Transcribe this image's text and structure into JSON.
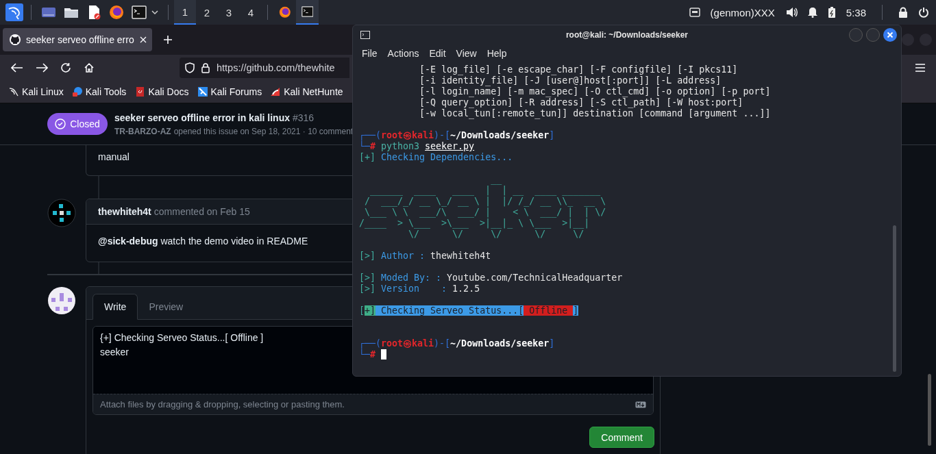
{
  "taskbar": {
    "launchers": [
      {
        "kind": "kali"
      },
      {
        "kind": "desktop"
      },
      {
        "kind": "files"
      },
      {
        "kind": "document"
      },
      {
        "kind": "browser"
      },
      {
        "kind": "terminal"
      }
    ],
    "workspaces": [
      {
        "label": "1",
        "selected": true
      },
      {
        "label": "2",
        "selected": false
      },
      {
        "label": "3",
        "selected": false
      },
      {
        "label": "4",
        "selected": false
      }
    ],
    "tasks": [
      {
        "kind": "browser",
        "selected": false
      },
      {
        "kind": "terminal",
        "selected": true
      }
    ],
    "tray": {
      "genmon": "(genmon)XXX",
      "clock": "5:38"
    }
  },
  "browser": {
    "tabs": [
      {
        "title": "seeker serveo offline erro",
        "selected": true
      }
    ],
    "address": "https://github.com/thewhite",
    "bookmarks": [
      {
        "label": "Kali Linux",
        "kind": "dragon"
      },
      {
        "label": "Kali Tools",
        "kind": "tools"
      },
      {
        "label": "Kali Docs",
        "kind": "docs"
      },
      {
        "label": "Kali Forums",
        "kind": "forums"
      },
      {
        "label": "Kali NetHunte",
        "kind": "nethunter"
      }
    ]
  },
  "issue": {
    "state": "Closed",
    "title": "seeker serveo offline error in kali linux",
    "number": "#316",
    "author": "TR-BARZO-AZ",
    "meta": "opened this issue on Sep 18, 2021 · 10 comment",
    "previous_comment_tail": "manual",
    "comment": {
      "author": "thewhiteh4t",
      "meta": "commented on Feb 15",
      "body": "**@sick-debug** watch the demo video in README"
    },
    "composer": {
      "tabs": [
        {
          "label": "Write",
          "selected": true
        },
        {
          "label": "Preview",
          "selected": false
        }
      ],
      "value": "{+] Checking Serveo Status...[ Offline ]\nseeker",
      "hint": "Attach files by dragging & dropping, selecting or pasting them.",
      "submit": "Comment"
    }
  },
  "terminal": {
    "title": "root@kali: ~/Downloads/seeker",
    "menu": [
      "File",
      "Actions",
      "Edit",
      "View",
      "Help"
    ],
    "lines": [
      {
        "kind": "text",
        "segments": [
          {
            "text": "           [-E log_file] [-e escape_char] [-F configfile] [-I pkcs11]",
            "kind": "plain"
          }
        ]
      },
      {
        "kind": "text",
        "segments": [
          {
            "text": "           [-i identity_file] [-J [user@]host[:port]] [-L address]",
            "kind": "plain"
          }
        ]
      },
      {
        "kind": "text",
        "segments": [
          {
            "text": "           [-l login_name] [-m mac_spec] [-O ctl_cmd] [-o option] [-p port]",
            "kind": "plain"
          }
        ]
      },
      {
        "kind": "text",
        "segments": [
          {
            "text": "           [-Q query_option] [-R address] [-S ctl_path] [-W host:port]",
            "kind": "plain"
          }
        ]
      },
      {
        "kind": "text",
        "segments": [
          {
            "text": "           [-w local_tun[:remote_tun]] destination [command [argument ...]]",
            "kind": "plain"
          }
        ]
      },
      {
        "kind": "blank"
      },
      {
        "kind": "text",
        "segments": [
          {
            "text": "┌──(",
            "kind": "box"
          },
          {
            "text": "root㉿kali",
            "kind": "user"
          },
          {
            "text": ")-[",
            "kind": "box"
          },
          {
            "text": "~/Downloads/seeker",
            "kind": "path"
          },
          {
            "text": "]",
            "kind": "box"
          }
        ]
      },
      {
        "kind": "text",
        "segments": [
          {
            "text": "└─",
            "kind": "box"
          },
          {
            "text": "# ",
            "kind": "user"
          },
          {
            "text": "python3 ",
            "kind": "cmd"
          },
          {
            "text": "seeker.py",
            "kind": "file"
          }
        ]
      },
      {
        "kind": "text",
        "segments": [
          {
            "text": "[+]",
            "kind": "tag"
          },
          {
            "text": " Checking Dependencies...",
            "kind": "info"
          }
        ]
      },
      {
        "kind": "blank"
      },
      {
        "kind": "text",
        "segments": [
          {
            "text": "                        __",
            "kind": "art"
          }
        ]
      },
      {
        "kind": "text",
        "segments": [
          {
            "text": "  ______  ____   ____  |  | __  ____ _______",
            "kind": "art"
          }
        ]
      },
      {
        "kind": "text",
        "segments": [
          {
            "text": " /  ___/_/ __ \\_/ __ \\ |  |/ /_/ __ \\\\_  __ \\",
            "kind": "art"
          }
        ]
      },
      {
        "kind": "text",
        "segments": [
          {
            "text": " \\___ \\ \\  ___/\\  ___/ |    < \\  ___/ |  | \\/",
            "kind": "art"
          }
        ]
      },
      {
        "kind": "text",
        "segments": [
          {
            "text": "/____  > \\___  >\\___  >|__|_ \\ \\___  >|__|",
            "kind": "art"
          }
        ]
      },
      {
        "kind": "text",
        "segments": [
          {
            "text": "         \\/      \\/     \\/      \\/     \\/",
            "kind": "art"
          }
        ]
      },
      {
        "kind": "blank"
      },
      {
        "kind": "text",
        "segments": [
          {
            "text": "[>]",
            "kind": "tag"
          },
          {
            "text": " Author : ",
            "kind": "info"
          },
          {
            "text": "thewhiteh4t",
            "kind": "plain"
          }
        ]
      },
      {
        "kind": "blank"
      },
      {
        "kind": "text",
        "segments": [
          {
            "text": "[>]",
            "kind": "tag"
          },
          {
            "text": " Moded By: : ",
            "kind": "info"
          },
          {
            "text": "Youtube.com/TechnicalHeadquarter",
            "kind": "plain"
          }
        ]
      },
      {
        "kind": "text",
        "segments": [
          {
            "text": "[>]",
            "kind": "tag"
          },
          {
            "text": " Version    : ",
            "kind": "info"
          },
          {
            "text": "1.2.5",
            "kind": "plain"
          }
        ]
      },
      {
        "kind": "blank"
      },
      {
        "kind": "text",
        "segments": [
          {
            "text": "[",
            "kind": "tag"
          },
          {
            "text": "+]",
            "kind": "hl-green"
          },
          {
            "text": " Checking Serveo Status...[",
            "kind": "hl-blue"
          },
          {
            "text": " Offline ",
            "kind": "hl-red"
          },
          {
            "text": "]",
            "kind": "hl-blue"
          }
        ]
      },
      {
        "kind": "blank"
      },
      {
        "kind": "blank"
      },
      {
        "kind": "text",
        "segments": [
          {
            "text": "┌──(",
            "kind": "box"
          },
          {
            "text": "root㉿kali",
            "kind": "user"
          },
          {
            "text": ")-[",
            "kind": "box"
          },
          {
            "text": "~/Downloads/seeker",
            "kind": "path"
          },
          {
            "text": "]",
            "kind": "box"
          }
        ]
      },
      {
        "kind": "text",
        "cursor": true,
        "segments": [
          {
            "text": "└─",
            "kind": "box"
          },
          {
            "text": "# ",
            "kind": "user"
          }
        ]
      }
    ]
  }
}
